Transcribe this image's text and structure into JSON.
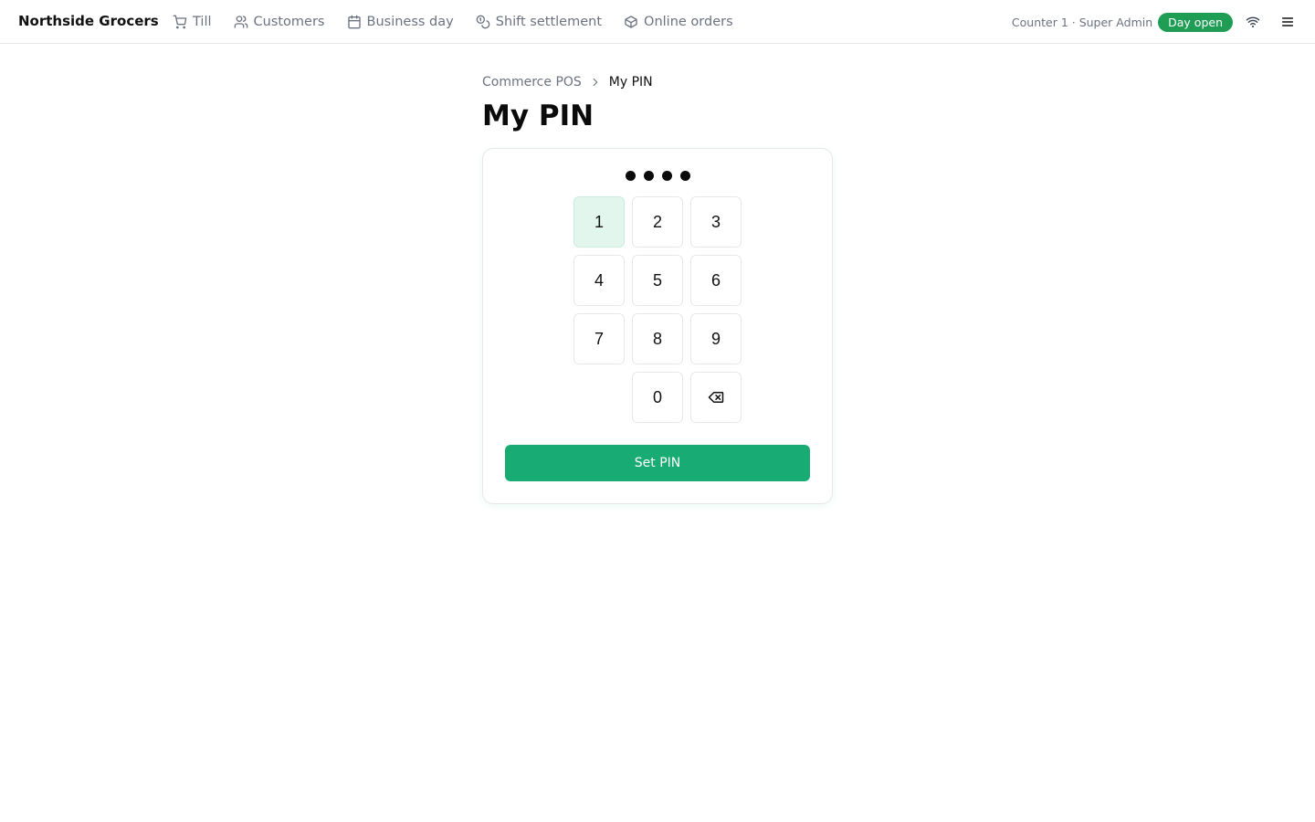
{
  "header": {
    "brand": "Northside Grocers",
    "nav": [
      {
        "label": "Till",
        "icon": "cart-icon"
      },
      {
        "label": "Customers",
        "icon": "users-icon"
      },
      {
        "label": "Business day",
        "icon": "calendar-icon"
      },
      {
        "label": "Shift settlement",
        "icon": "coins-icon"
      },
      {
        "label": "Online orders",
        "icon": "package-icon"
      }
    ],
    "session": "Counter 1 · Super Admin",
    "status_badge": "Day open",
    "connection_icon": "wifi-icon",
    "menu_icon": "hamburger-menu-icon"
  },
  "breadcrumb": {
    "root": "Commerce POS",
    "separator_icon": "chevron-right-icon",
    "current": "My PIN"
  },
  "page_title": "My PIN",
  "pin": {
    "entered_digits": 4,
    "keys": [
      "1",
      "2",
      "3",
      "4",
      "5",
      "6",
      "7",
      "8",
      "9",
      "0"
    ],
    "highlighted_key": "1",
    "backspace_icon": "backspace-icon",
    "submit_label": "Set PIN"
  },
  "colors": {
    "accent": "#19ab74",
    "badge": "#1f9d55",
    "key_highlight": "#e3f6ee"
  }
}
